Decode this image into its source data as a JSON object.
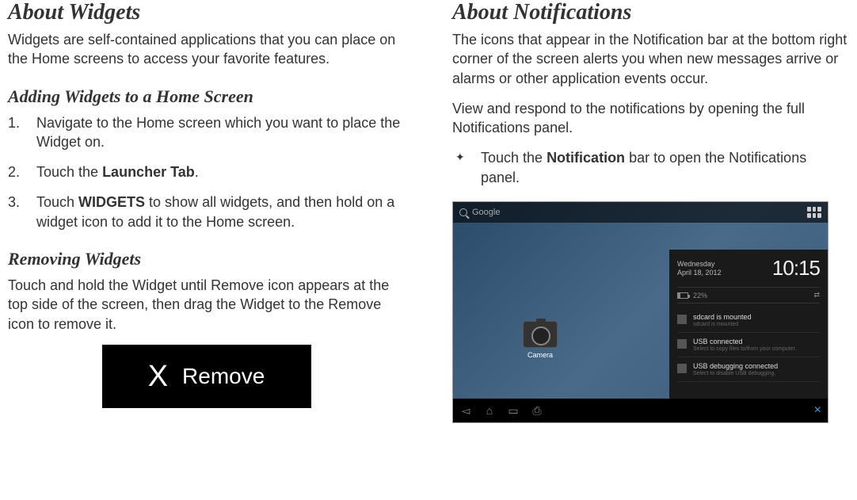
{
  "left": {
    "h1": "About Widgets",
    "intro": "Widgets are self-contained applications that you can place on the Home screens to access your favorite features.",
    "h2a": "Adding Widgets to a Home Screen",
    "steps": {
      "s1": "Navigate to the Home screen which you want to place the Widget on.",
      "s2a": "Touch the ",
      "s2b": "Launcher Tab",
      "s2c": ".",
      "s3a": "Touch ",
      "s3b": "WIDGETS",
      "s3c": " to show all widgets, and then hold on a widget icon to add it to the Home screen."
    },
    "h2b": "Removing Widgets",
    "removing": "Touch and hold the Widget until Remove icon appears at the top side of the screen, then drag the Widget to the Remove icon to remove it.",
    "removeBadge": {
      "x": "X",
      "label": "Remove"
    }
  },
  "right": {
    "h1": "About Notifications",
    "p1": "The icons that appear in the Notification bar at the bottom right corner of the screen alerts you when new messages arrive or alarms or other application events occur.",
    "p2": "View and respond to the notifications by opening the full Notifications panel.",
    "bullet": {
      "a": "Touch the ",
      "b": "Notification",
      "c": " bar to open the Notifications panel."
    },
    "screenshot": {
      "searchLabel": "Google",
      "cameraLabel": "Camera",
      "day": "Wednesday",
      "date": "April 18, 2012",
      "time": "10:15",
      "battery": "22%",
      "items": [
        {
          "title": "sdcard is mounted",
          "sub": "sdcard is mounted"
        },
        {
          "title": "USB connected",
          "sub": "Select to copy files to/from your computer."
        },
        {
          "title": "USB debugging connected",
          "sub": "Select to disable USB debugging."
        }
      ]
    }
  }
}
